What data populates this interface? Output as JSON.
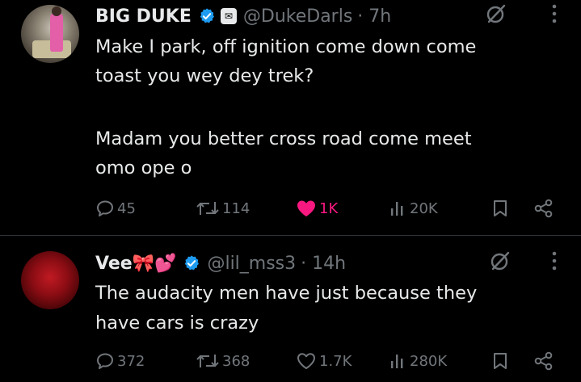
{
  "tweets": [
    {
      "display_name": "BIG DUKE",
      "affiliation_badge": "✉",
      "handle": "@DukeDarls",
      "time": "· 7h",
      "body_lines": [
        "Make I park, off ignition come down come",
        "toast you wey dey trek?",
        "",
        "Madam you better cross road come meet",
        "omo ope o"
      ],
      "replies": "45",
      "retweets": "114",
      "likes": "1K",
      "liked": true,
      "views": "20K",
      "avatar_icon": "profile-photo"
    },
    {
      "display_name": "Vee🎀💕",
      "handle": "@lil_mss3",
      "time": "· 14h",
      "body_lines": [
        "The audacity men have just because they",
        "have cars is crazy"
      ],
      "replies": "372",
      "retweets": "368",
      "likes": "1.7K",
      "liked": false,
      "views": "280K",
      "avatar_icon": "profile-photo"
    }
  ],
  "colors": {
    "background": "#000000",
    "text": "#e7e9ea",
    "muted": "#71767b",
    "like_active": "#f91880",
    "verified": "#1d9bf0",
    "divider": "#2f3336"
  },
  "icons": {
    "reply": "reply-icon",
    "retweet": "retweet-icon",
    "like": "heart-icon",
    "views": "views-icon",
    "bookmark": "bookmark-icon",
    "share": "share-icon",
    "grok": "grok-icon",
    "more": "more-icon",
    "verified": "verified-badge-icon"
  }
}
